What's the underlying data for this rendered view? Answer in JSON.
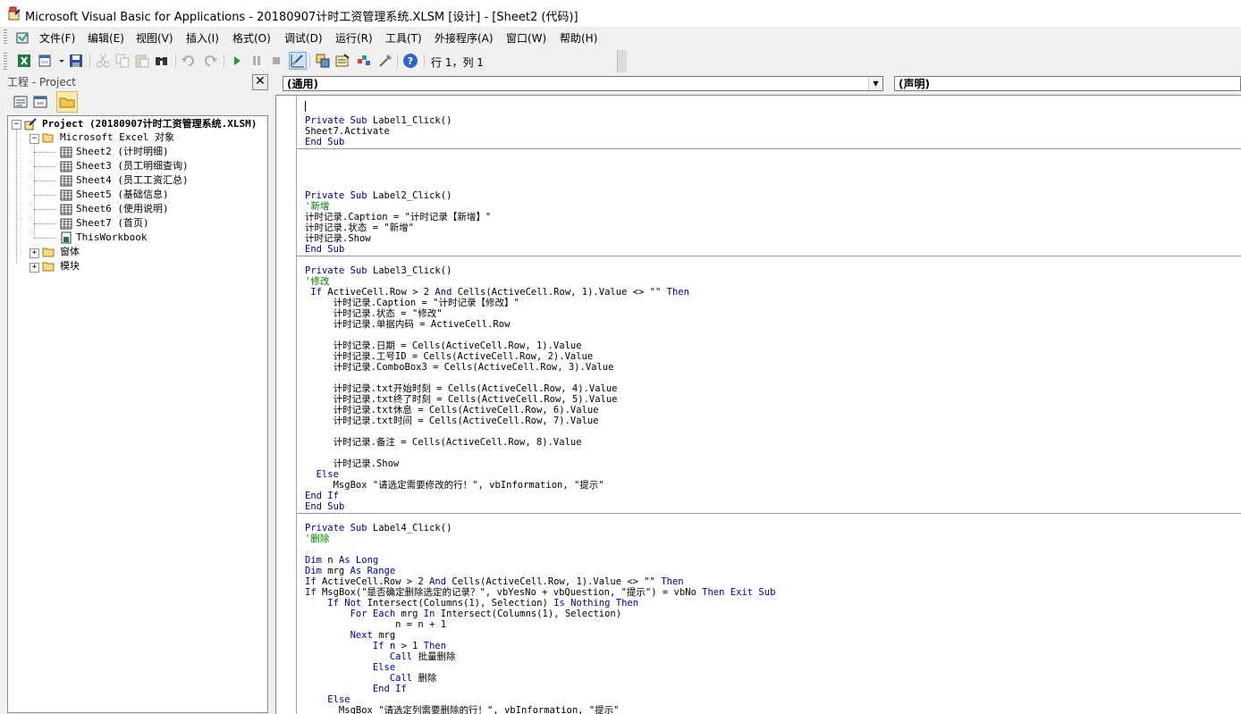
{
  "window": {
    "title": "Microsoft Visual Basic for Applications - 20180907计时工资管理系统.XLSM [设计] - [Sheet2 (代码)]"
  },
  "menu": [
    "文件(F)",
    "编辑(E)",
    "视图(V)",
    "插入(I)",
    "格式(O)",
    "调试(D)",
    "运行(R)",
    "工具(T)",
    "外接程序(A)",
    "窗口(W)",
    "帮助(H)"
  ],
  "toolbar": {
    "buttons": [
      "view-excel-icon",
      "insert-userform-icon",
      "save-icon",
      "cut-icon",
      "copy-icon",
      "paste-icon",
      "find-icon",
      "undo-icon",
      "redo-icon",
      "run-icon",
      "break-icon",
      "reset-icon",
      "design-mode-icon",
      "project-explorer-icon",
      "properties-window-icon",
      "object-browser-icon",
      "toolbox-icon",
      "help-icon"
    ],
    "position": "行 1，列 1"
  },
  "project_pane": {
    "title": "工程 - Project",
    "close": "✕",
    "tree": {
      "root": "Project (20180907计时工资管理系统.XLSM)",
      "excel_objects": "Microsoft Excel 对象",
      "sheets": [
        "Sheet2 (计时明细)",
        "Sheet3 (员工明细查询)",
        "Sheet4 (员工工资汇总)",
        "Sheet5 (基础信息)",
        "Sheet6 (使用说明)",
        "Sheet7 (首页)",
        "ThisWorkbook"
      ],
      "forms": "窗体",
      "modules": "模块"
    }
  },
  "code_window": {
    "object_combo": "(通用)",
    "proc_combo": "(声明)",
    "lines": [
      "",
      "Private Sub Label1_Click()",
      "Sheet7.Activate",
      "End Sub",
      "",
      "",
      "",
      "",
      "Private Sub Label2_Click()",
      "'新增",
      "计时记录.Caption = \"计时记录【新增】\"",
      "计时记录.状态 = \"新增\"",
      "计时记录.Show",
      "End Sub",
      "",
      "Private Sub Label3_Click()",
      "'修改",
      " If ActiveCell.Row > 2 And Cells(ActiveCell.Row, 1).Value <> \"\" Then",
      "     计时记录.Caption = \"计时记录【修改】\"",
      "     计时记录.状态 = \"修改\"",
      "     计时记录.单据内码 = ActiveCell.Row",
      "",
      "     计时记录.日期 = Cells(ActiveCell.Row, 1).Value",
      "     计时记录.工号ID = Cells(ActiveCell.Row, 2).Value",
      "     计时记录.ComboBox3 = Cells(ActiveCell.Row, 3).Value",
      "",
      "     计时记录.txt开始时刻 = Cells(ActiveCell.Row, 4).Value",
      "     计时记录.txt终了时刻 = Cells(ActiveCell.Row, 5).Value",
      "     计时记录.txt休息 = Cells(ActiveCell.Row, 6).Value",
      "     计时记录.txt时间 = Cells(ActiveCell.Row, 7).Value",
      "",
      "     计时记录.备注 = Cells(ActiveCell.Row, 8).Value",
      "",
      "     计时记录.Show",
      "  Else",
      "     MsgBox \"请选定需要修改的行！\", vbInformation, \"提示\"",
      "End If",
      "End Sub",
      "",
      "Private Sub Label4_Click()",
      "'删除",
      "",
      "Dim n As Long",
      "Dim mrg As Range",
      "If ActiveCell.Row > 2 And Cells(ActiveCell.Row, 1).Value <> \"\" Then",
      "If MsgBox(\"是否确定删除选定的记录？\", vbYesNo + vbQuestion, \"提示\") = vbNo Then Exit Sub",
      "    If Not Intersect(Columns(1), Selection) Is Nothing Then",
      "        For Each mrg In Intersect(Columns(1), Selection)",
      "                n = n + 1",
      "        Next mrg",
      "            If n > 1 Then",
      "               Call 批量删除",
      "            Else",
      "               Call 删除",
      "            End If",
      "    Else",
      "      MsgBox \"请选定列需要删除的行！\", vbInformation, \"提示\""
    ]
  }
}
